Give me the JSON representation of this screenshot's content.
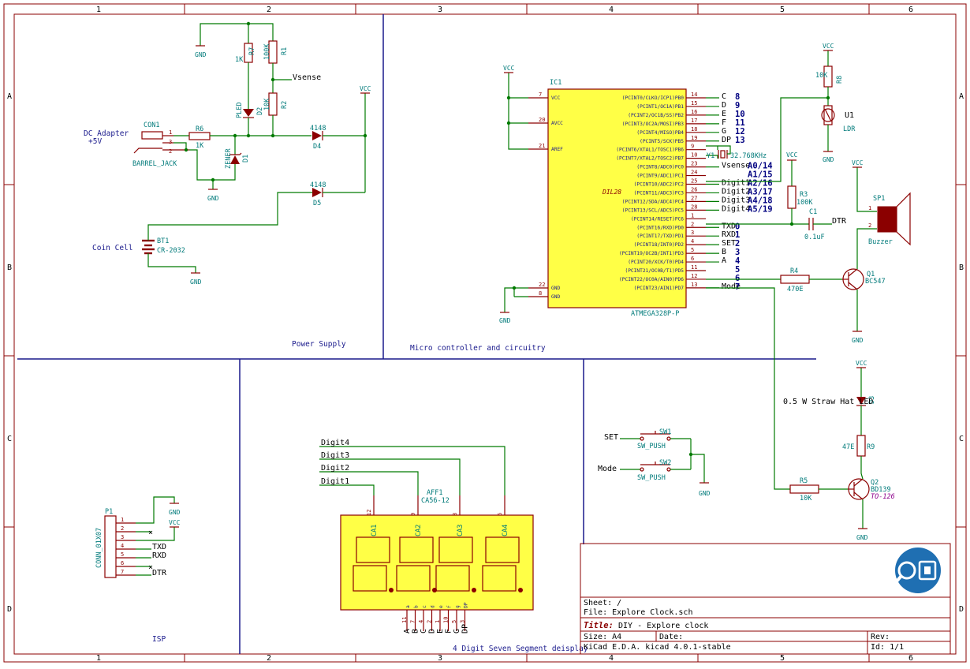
{
  "frame": {
    "cols": [
      "1",
      "2",
      "3",
      "4",
      "5",
      "6"
    ],
    "rows": [
      "A",
      "B",
      "C",
      "D"
    ]
  },
  "sections": {
    "power": "Power Supply",
    "micro": "Micro controller and circuitry",
    "isp": "ISP",
    "display": "4 Digit Seven Segment deisplay"
  },
  "power": {
    "dc_adapter": "DC Adapter",
    "dc_volt": "+5V",
    "con1": "CON1",
    "barrel": "BARREL_JACK",
    "r6": "R6",
    "r6v": "1K",
    "r7": "R7",
    "r7v": "1K",
    "r1": "R1",
    "r1v": "100K",
    "r2": "R2",
    "r2v": "10K",
    "d2": "D2",
    "pled": "PLED",
    "d1": "D1",
    "zener": "ZENER",
    "d4": "D4",
    "d4v": "4148",
    "d5": "D5",
    "d5v": "4148",
    "vsense": "Vsense",
    "gnd": "GND",
    "vcc": "VCC",
    "coin": "Coin Cell",
    "bt1": "BT1",
    "bt1v": "CR-2032",
    "pin1": "1",
    "pin2": "2",
    "pin3": "3"
  },
  "mcu": {
    "ic": "IC1",
    "part": "ATMEGA328P-P",
    "pkg": "DIL28",
    "left_pins": [
      {
        "name": "VCC",
        "num": "7"
      },
      {
        "name": "AVCC",
        "num": "20"
      },
      {
        "name": "AREF",
        "num": "21"
      },
      {
        "name": "GND",
        "num": "22"
      },
      {
        "name": "GND",
        "num": "8"
      }
    ],
    "right_pins": [
      {
        "name": "(PCINT0/CLKO/ICP1)PB0",
        "num": "14",
        "net": "C",
        "idx": "8"
      },
      {
        "name": "(PCINT1/OC1A)PB1",
        "num": "15",
        "net": "D",
        "idx": "9"
      },
      {
        "name": "(PCINT2/OC1B/SS)PB2",
        "num": "16",
        "net": "E",
        "idx": "10"
      },
      {
        "name": "(PCINT3/OC2A/MOSI)PB3",
        "num": "17",
        "net": "F",
        "idx": "11"
      },
      {
        "name": "(PCINT4/MISO)PB4",
        "num": "18",
        "net": "G",
        "idx": "12"
      },
      {
        "name": "(PCINT5/SCK)PB5",
        "num": "19",
        "net": "DP",
        "idx": "13"
      },
      {
        "name": "(PCINT6/XTAL1/TOSC1)PB6",
        "num": "9",
        "net": "",
        "idx": ""
      },
      {
        "name": "(PCINT7/XTAL2/TOSC2)PB7",
        "num": "10",
        "net": "",
        "idx": ""
      },
      {
        "name": "(PCINT8/ADC0)PC0",
        "num": "23",
        "net": "Vsense",
        "idx": "A0/14"
      },
      {
        "name": "(PCINT9/ADC1)PC1",
        "num": "24",
        "net": "",
        "idx": "A1/15"
      },
      {
        "name": "(PCINT10/ADC2)PC2",
        "num": "25",
        "net": "Digit1",
        "idx": "A2/16"
      },
      {
        "name": "(PCINT11/ADC3)PC3",
        "num": "26",
        "net": "Digit2",
        "idx": "A3/17"
      },
      {
        "name": "(PCINT12/SDA/ADC4)PC4",
        "num": "27",
        "net": "Digit3",
        "idx": "A4/18"
      },
      {
        "name": "(PCINT13/SCL/ADC5)PC5",
        "num": "28",
        "net": "Digit4",
        "idx": "A5/19"
      },
      {
        "name": "(PCINT14/RESET)PC6",
        "num": "1",
        "net": "",
        "idx": ""
      },
      {
        "name": "(PCINT16/RXD)PD0",
        "num": "2",
        "net": "TXD",
        "idx": "0"
      },
      {
        "name": "(PCINT17/TXD)PD1",
        "num": "3",
        "net": "RXD",
        "idx": "1"
      },
      {
        "name": "(PCINT18/INT0)PD2",
        "num": "4",
        "net": "SET",
        "idx": "2"
      },
      {
        "name": "(PCINT19/OC2B/INT1)PD3",
        "num": "5",
        "net": "B",
        "idx": "3"
      },
      {
        "name": "(PCINT20/XCK/T0)PD4",
        "num": "6",
        "net": "A",
        "idx": "4"
      },
      {
        "name": "(PCINT21/OC0B/T1)PD5",
        "num": "11",
        "net": "",
        "idx": "5"
      },
      {
        "name": "(PCINT22/OC0A/AIN0)PD6",
        "num": "12",
        "net": "",
        "idx": "6"
      },
      {
        "name": "(PCINT23/AIN1)PD7",
        "num": "13",
        "net": "Mode",
        "idx": "7"
      }
    ],
    "y1": "Y1",
    "y1v": "32.768KHz",
    "r8": "R8",
    "r8v": "10K",
    "u1": "U1",
    "ldr": "LDR",
    "r3": "R3",
    "r3v": "100K",
    "c1": "C1",
    "c1v": "0.1uF",
    "dtr": "DTR",
    "sp1": "SP1",
    "buzzer": "Buzzer",
    "r4": "R4",
    "r4v": "470E",
    "q1": "Q1",
    "q1v": "BC547",
    "led_note": "0.5 W Straw Hat LED",
    "d3": "D3",
    "r9": "R9",
    "r9v": "47E",
    "r5": "R5",
    "r5v": "10K",
    "q2": "Q2",
    "q2v": "BD139",
    "q2pkg": "TO-126",
    "sw1": "SW1",
    "sw2": "SW2",
    "swv": "SW_PUSH",
    "set": "SET",
    "mode": "Mode"
  },
  "isp": {
    "p1": "P1",
    "conn": "CONN_01X07",
    "pins": [
      "1",
      "2",
      "3",
      "4",
      "5",
      "6",
      "7"
    ],
    "txd": "TXD",
    "rxd": "RXD",
    "dtr": "DTR"
  },
  "display": {
    "aff": "AFF1",
    "part": "CA56-12",
    "digits": [
      "Digit4",
      "Digit3",
      "Digit2",
      "Digit1"
    ],
    "common": [
      "CA1",
      "CA2",
      "CA3",
      "CA4"
    ],
    "common_pins": [
      "12",
      "9",
      "8",
      "6"
    ],
    "seg_names": [
      "a",
      "b",
      "c",
      "d",
      "e",
      "f",
      "g",
      "DP"
    ],
    "seg_pins": [
      "11",
      "7",
      "4",
      "2",
      "1",
      "10",
      "5",
      "3"
    ],
    "seg_nets": [
      "A",
      "B",
      "C",
      "D",
      "E",
      "F",
      "G",
      "DP"
    ]
  },
  "titleblock": {
    "sheet_l": "Sheet: /",
    "file_l": "File: Explore Clock.sch",
    "title_k": "Title:",
    "title_v": "DIY - Explore clock",
    "size": "Size: A4",
    "date": "Date:",
    "rev": "Rev:",
    "tool": "KiCad E.D.A.  kicad 4.0.1-stable",
    "id": "Id: 1/1"
  },
  "colors": {
    "frame": "#8b0000",
    "wire": "#007a00",
    "ic": "#ffff46",
    "bus": "#1a1a8c"
  }
}
